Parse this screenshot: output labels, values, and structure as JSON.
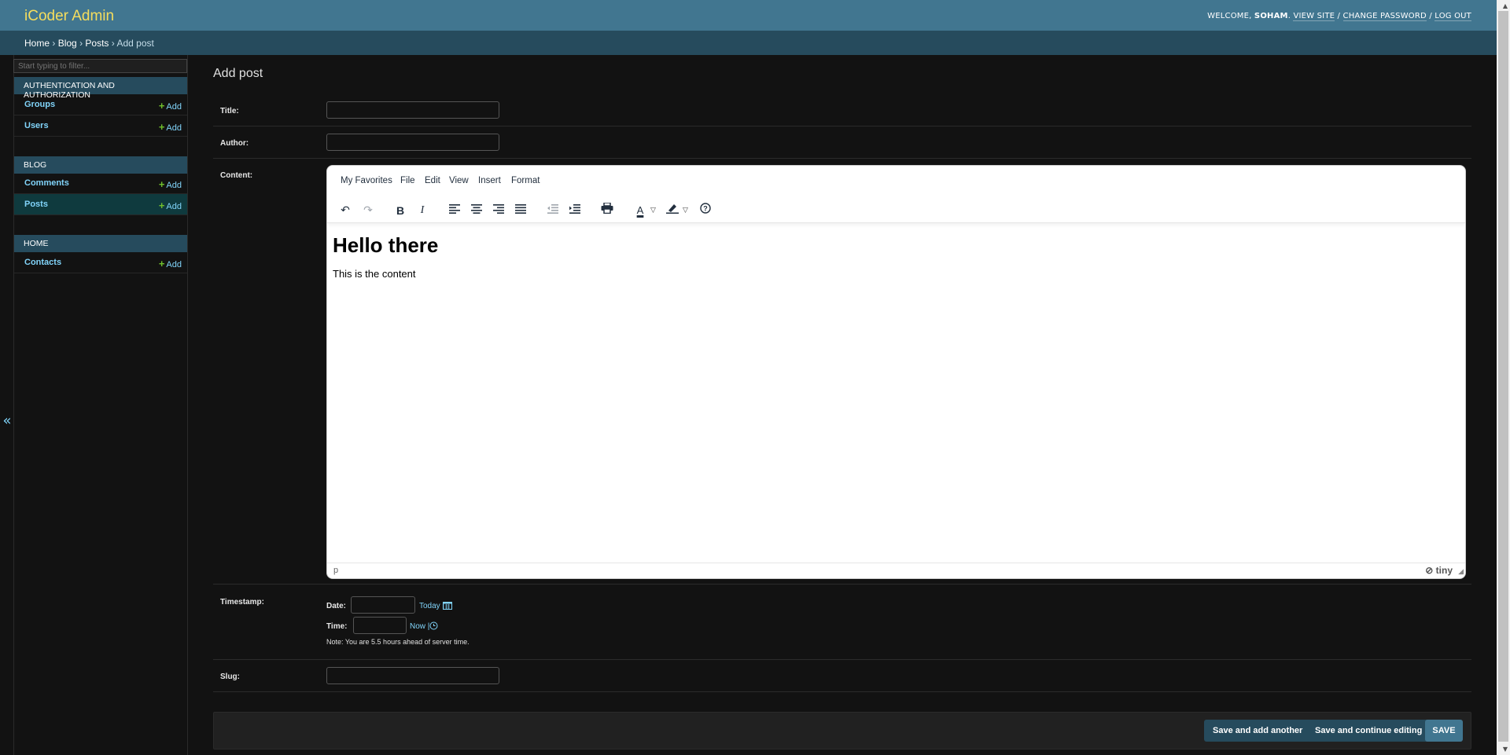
{
  "header": {
    "site_title": "iCoder Admin",
    "welcome": "WELCOME,",
    "username": "SOHAM",
    "view_site": "VIEW SITE",
    "change_password": "CHANGE PASSWORD",
    "log_out": "LOG OUT",
    "separator": "/"
  },
  "breadcrumbs": {
    "home": "Home",
    "blog": "Blog",
    "posts": "Posts",
    "current": "Add post",
    "sep": "›"
  },
  "sidebar": {
    "filter_placeholder": "Start typing to filter...",
    "add_label": "Add",
    "modules": [
      {
        "caption": "AUTHENTICATION AND AUTHORIZATION",
        "models": [
          "Groups",
          "Users"
        ]
      },
      {
        "caption": "BLOG",
        "models": [
          "Comments",
          "Posts"
        ]
      },
      {
        "caption": "HOME",
        "models": [
          "Contacts"
        ]
      }
    ],
    "collapse_glyph": "«"
  },
  "form": {
    "page_title": "Add post",
    "title_label": "Title:",
    "author_label": "Author:",
    "content_label": "Content:",
    "timestamp_label": "Timestamp:",
    "slug_label": "Slug:",
    "date_label": "Date:",
    "time_label": "Time:",
    "today_link": "Today",
    "now_link": "Now",
    "pipe": "|",
    "tz_note": "Note: You are 5.5 hours ahead of server time."
  },
  "editor": {
    "menus": [
      "My Favorites",
      "File",
      "Edit",
      "View",
      "Insert",
      "Format"
    ],
    "heading": "Hello there",
    "paragraph": "This is the content",
    "status_path": "p",
    "brand": "tiny"
  },
  "submit": {
    "save_add_another": "Save and add another",
    "save_continue": "Save and continue editing",
    "save": "SAVE"
  }
}
